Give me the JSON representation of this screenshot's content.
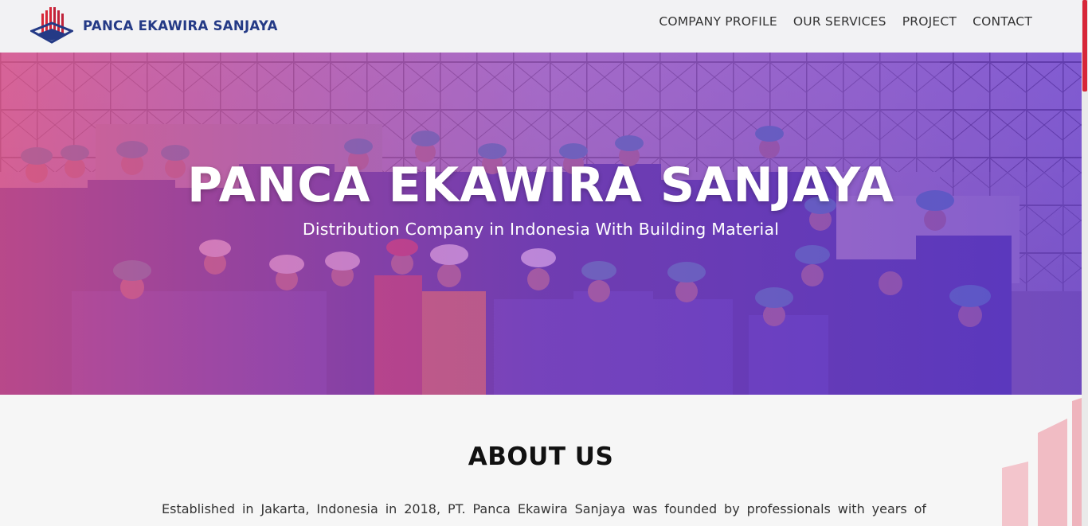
{
  "header": {
    "brand_name": "PANCA EKAWIRA SANJAYA",
    "logo_icon": "building-bars-logo-icon",
    "nav": [
      {
        "label": "COMPANY PROFILE"
      },
      {
        "label": "OUR SERVICES"
      },
      {
        "label": "PROJECT"
      },
      {
        "label": "CONTACT"
      }
    ]
  },
  "hero": {
    "title": "PANCA EKAWIRA SANJAYA",
    "subtitle": "Distribution Company in Indonesia With Building Material",
    "background_image": "workers-group-photo"
  },
  "about": {
    "title": "ABOUT US",
    "text": "Established in Jakarta, Indonesia in 2018, PT. Panca Ekawira Sanjaya was founded by professionals with years of"
  },
  "colors": {
    "brand": "#243a86",
    "accent": "#d72638",
    "hero_overlay_start": "#e0508a",
    "hero_overlay_end": "#6a3bd6",
    "page_bg": "#f6f6f6"
  }
}
